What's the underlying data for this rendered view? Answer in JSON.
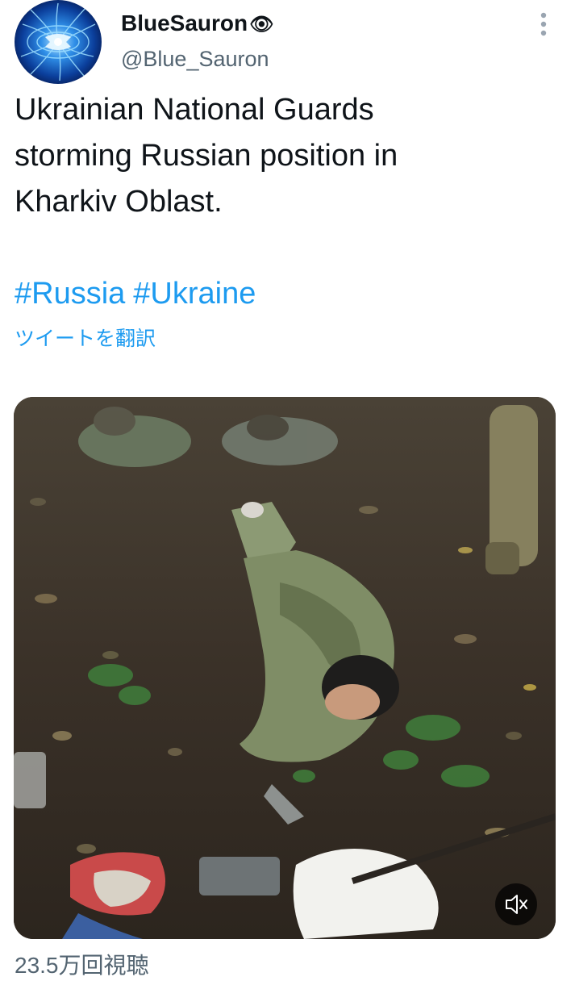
{
  "author": {
    "display_name": "BlueSauron",
    "name_emoji": "👁",
    "handle": "@Blue_Sauron",
    "avatar_icon": "blue-energy-orb-avatar"
  },
  "header": {
    "more_icon": "more-vertical-icon"
  },
  "tweet": {
    "text_lines": [
      "Ukrainian National Guards",
      "storming Russian position in",
      "Kharkiv Oblast."
    ],
    "hashtags": [
      "#Russia",
      "#Ukraine"
    ],
    "translate_label": "ツイートを翻訳"
  },
  "media": {
    "type": "video",
    "mute_icon": "speaker-muted-icon",
    "description_icon": "video-frame-soldiers-lying-on-forest-floor"
  },
  "stats": {
    "views": "23.5万回視聴"
  },
  "colors": {
    "link": "#1d9bf0",
    "secondary_text": "#536471",
    "primary_text": "#0f1419"
  }
}
